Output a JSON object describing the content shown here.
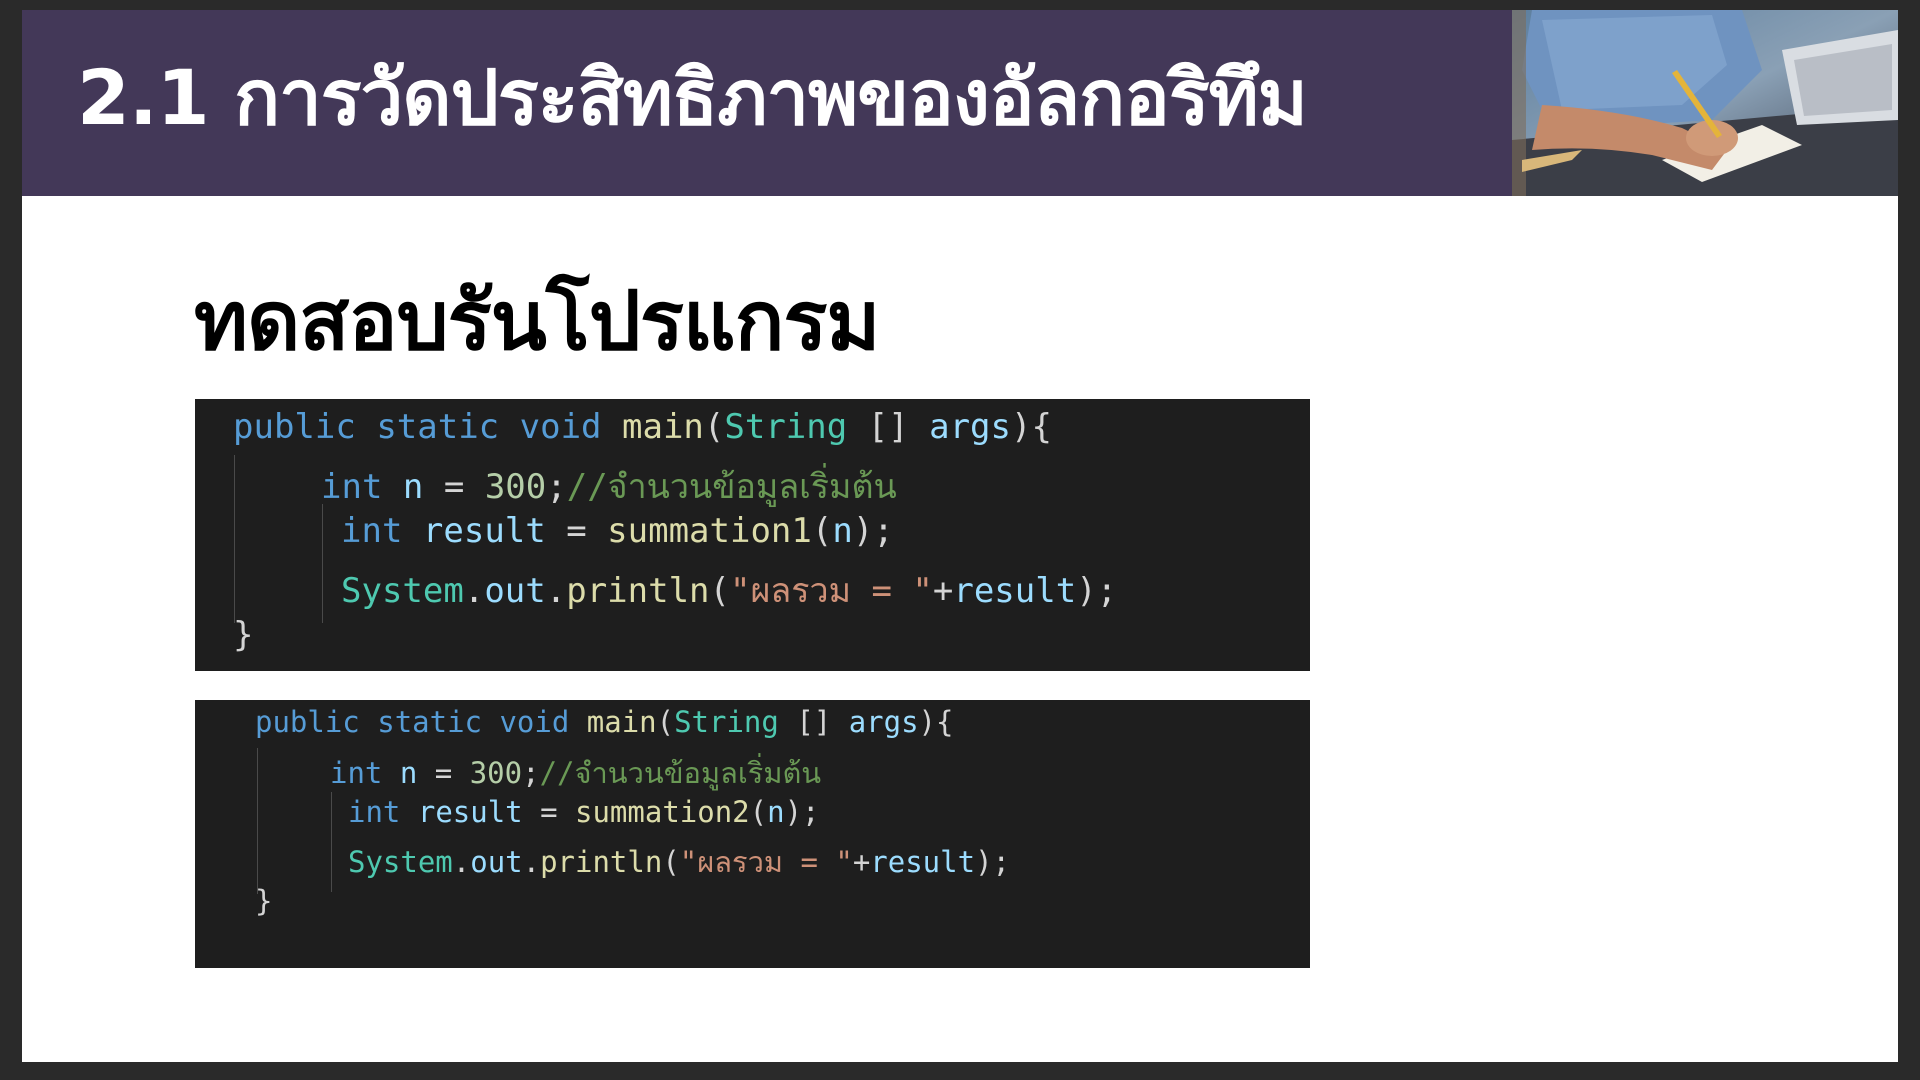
{
  "header": {
    "title": "2.1 การวัดประสิทธิภาพของอัลกอริทึม"
  },
  "slide": {
    "subtitle": "ทดสอบรันโปรแกรม"
  },
  "code_block_1": {
    "line1": {
      "kw1": "public",
      "kw2": "static",
      "kw3": "void",
      "fn": "main",
      "p1": "(",
      "type": "String",
      "p2": " [] ",
      "param": "args",
      "p3": "){"
    },
    "line2": {
      "kw": "int",
      "var": "n",
      "p1": " = ",
      "num": "300",
      "p2": ";",
      "comment": "//จำนวนข้อมูลเริ่มต้น"
    },
    "line3": {
      "kw": "int",
      "var": "result",
      "p1": " = ",
      "fn": "summation1",
      "p2": "(",
      "arg": "n",
      "p3": ");"
    },
    "line4": {
      "cls": "System",
      "p1": ".",
      "field": "out",
      "p2": ".",
      "fn": "println",
      "p3": "(",
      "str": "\"ผลรวม = \"",
      "p4": "+",
      "var": "result",
      "p5": ");"
    },
    "line5": {
      "p": "}"
    }
  },
  "code_block_2": {
    "line1": {
      "kw1": "public",
      "kw2": "static",
      "kw3": "void",
      "fn": "main",
      "p1": "(",
      "type": "String",
      "p2": " [] ",
      "param": "args",
      "p3": "){"
    },
    "line2": {
      "kw": "int",
      "var": "n",
      "p1": " = ",
      "num": "300",
      "p2": ";",
      "comment": "//จำนวนข้อมูลเริ่มต้น"
    },
    "line3": {
      "kw": "int",
      "var": "result",
      "p1": " = ",
      "fn": "summation2",
      "p2": "(",
      "arg": "n",
      "p3": ");"
    },
    "line4": {
      "cls": "System",
      "p1": ".",
      "field": "out",
      "p2": ".",
      "fn": "println",
      "p3": "(",
      "str": "\"ผลรวม = \"",
      "p4": "+",
      "var": "result",
      "p5": ");"
    },
    "line5": {
      "p": "}"
    }
  },
  "colors": {
    "header_bg": "#433858",
    "code_bg": "#1e1e1e",
    "keyword": "#569cd6",
    "type": "#4ec9b0",
    "function": "#dcdcaa",
    "variable": "#9cdcfe",
    "number": "#b5cea8",
    "string": "#ce9178",
    "comment": "#6a9955"
  },
  "icons": {
    "header_photo": "person-writing-at-desk-photo"
  }
}
